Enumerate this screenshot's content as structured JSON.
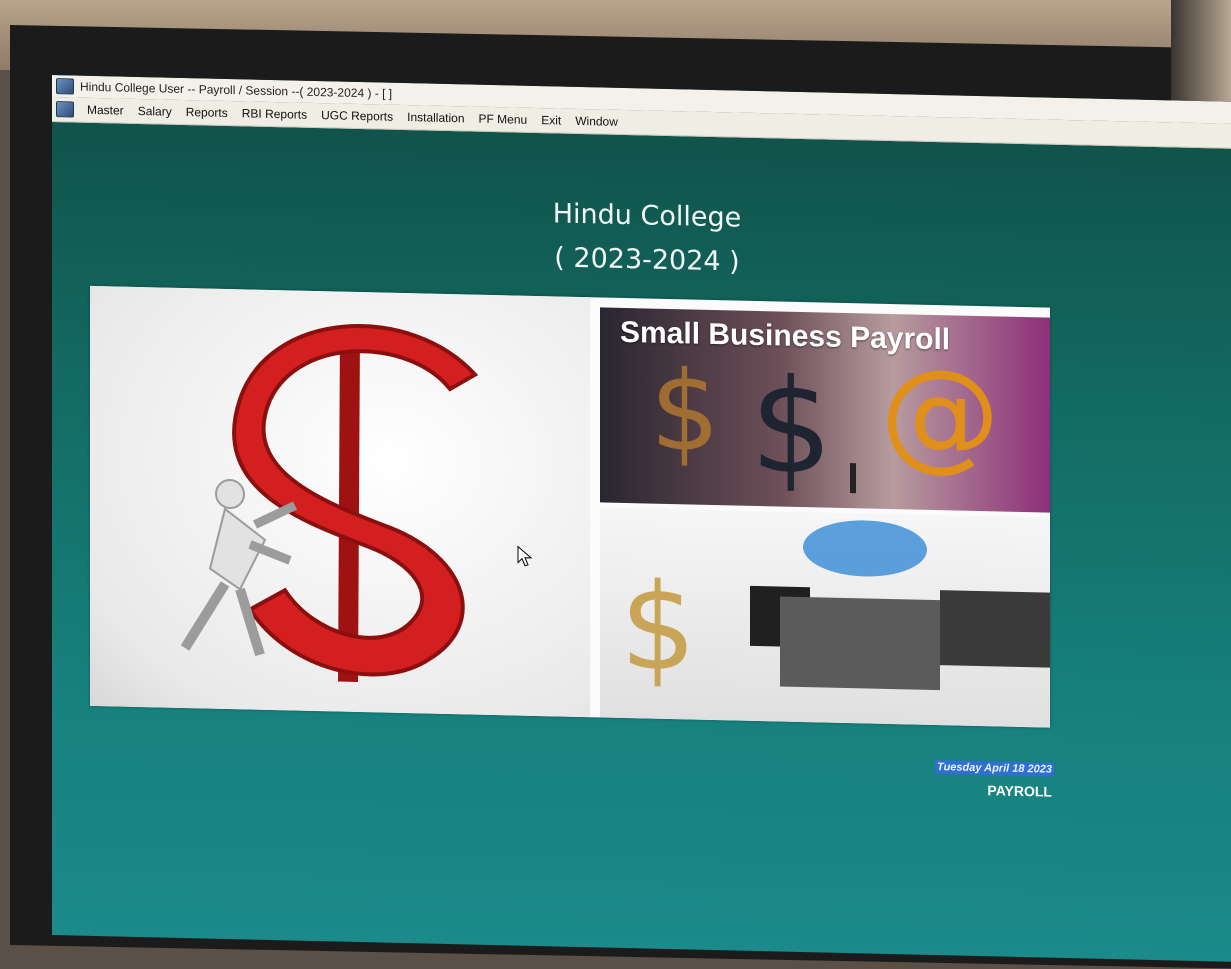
{
  "window": {
    "title": "Hindu College User -- Payroll / Session --( 2023-2024 ) - [ ]"
  },
  "menu": {
    "items": [
      "Master",
      "Salary",
      "Reports",
      "RBI Reports",
      "UGC Reports",
      "Installation",
      "PF Menu",
      "Exit",
      "Window"
    ]
  },
  "main": {
    "college_name": "Hindu College",
    "session": "( 2023-2024 )",
    "banner_title": "Small Business Payroll",
    "date": "Tuesday April 18 2023",
    "module": "PAYROLL"
  },
  "colors": {
    "screen_background": "#136a62",
    "dollar_red": "#d31f1f",
    "date_highlight": "#2f6fd0"
  }
}
